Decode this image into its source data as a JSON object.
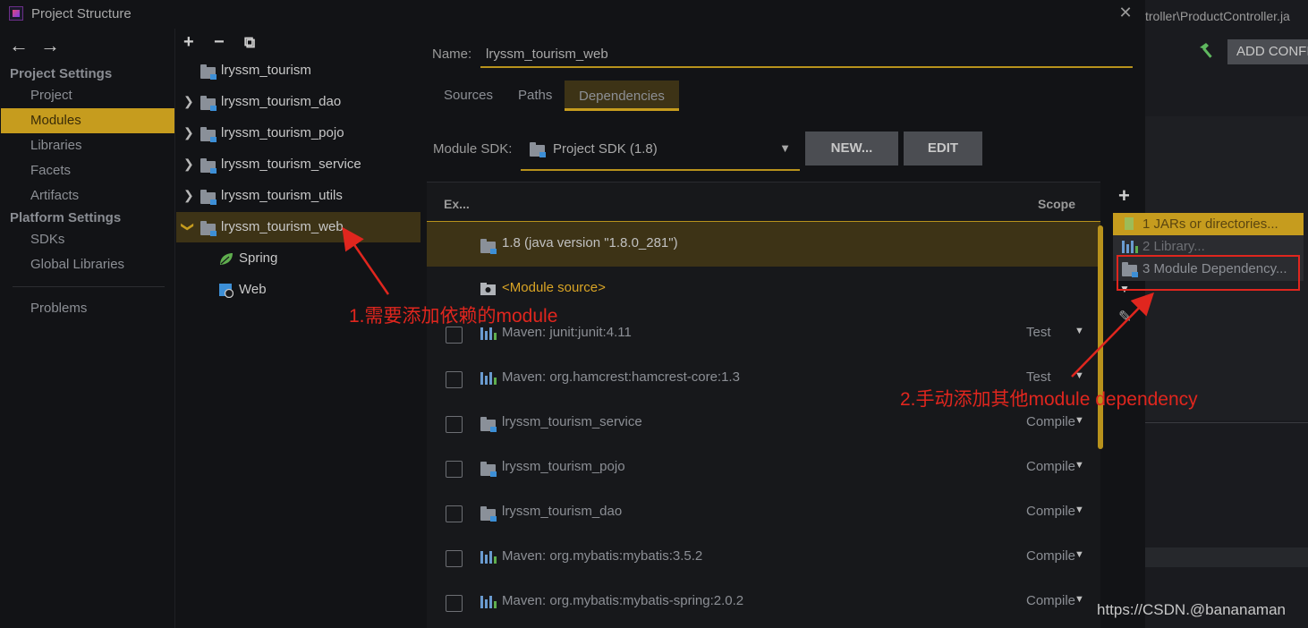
{
  "window": {
    "title": "Project Structure"
  },
  "background_ide": {
    "path": "troller\\ProductController.ja",
    "run_config_button": "ADD CONFI"
  },
  "nav": {
    "back": "←",
    "forward": "→",
    "project_settings_heading": "Project Settings",
    "project_settings_items": [
      "Project",
      "Modules",
      "Libraries",
      "Facets",
      "Artifacts"
    ],
    "platform_settings_heading": "Platform Settings",
    "platform_settings_items": [
      "SDKs",
      "Global Libraries"
    ],
    "problems": "Problems",
    "selected": "Modules"
  },
  "tree": {
    "toolbar": {
      "add": "+",
      "remove": "−",
      "copy": "⧉"
    },
    "items": [
      {
        "label": "lryssm_tourism",
        "expandable": false
      },
      {
        "label": "lryssm_tourism_dao",
        "expandable": true
      },
      {
        "label": "lryssm_tourism_pojo",
        "expandable": true
      },
      {
        "label": "lryssm_tourism_service",
        "expandable": true
      },
      {
        "label": "lryssm_tourism_utils",
        "expandable": true
      },
      {
        "label": "lryssm_tourism_web",
        "expandable": true,
        "expanded": true,
        "selected": true
      },
      {
        "label": "Spring",
        "child": true
      },
      {
        "label": "Web",
        "child": true
      }
    ]
  },
  "module": {
    "name_label": "Name:",
    "name_value": "lryssm_tourism_web",
    "tabs": [
      "Sources",
      "Paths",
      "Dependencies"
    ],
    "active_tab": "Dependencies",
    "sdk_label": "Module SDK:",
    "sdk_value": "Project SDK (1.8)",
    "new_button": "NEW...",
    "edit_button": "EDIT"
  },
  "dependencies": {
    "col_export": "Ex...",
    "col_scope": "Scope",
    "rows": [
      {
        "label": "1.8 (java version \"1.8.0_281\")",
        "scope": "",
        "icon": "sdk-folder-icon",
        "selected": true
      },
      {
        "label": "<Module source>",
        "scope": "",
        "icon": "module-source-icon"
      },
      {
        "label": "Maven: junit:junit:4.11",
        "scope": "Test",
        "icon": "library-bars-icon"
      },
      {
        "label": "Maven: org.hamcrest:hamcrest-core:1.3",
        "scope": "Test",
        "icon": "library-bars-icon"
      },
      {
        "label": "lryssm_tourism_service",
        "scope": "Compile",
        "icon": "module-folder-icon"
      },
      {
        "label": "lryssm_tourism_pojo",
        "scope": "Compile",
        "icon": "module-folder-icon"
      },
      {
        "label": "lryssm_tourism_dao",
        "scope": "Compile",
        "icon": "module-folder-icon"
      },
      {
        "label": "Maven: org.mybatis:mybatis:3.5.2",
        "scope": "Compile",
        "icon": "library-bars-icon"
      },
      {
        "label": "Maven: org.mybatis:mybatis-spring:2.0.2",
        "scope": "Compile",
        "icon": "library-bars-icon"
      }
    ]
  },
  "side_toolbar": {
    "add": "+",
    "edit": "✎"
  },
  "popup": {
    "items": [
      {
        "label": "1  JARs or directories..."
      },
      {
        "label": "2  Library..."
      },
      {
        "label": "3  Module Dependency..."
      }
    ]
  },
  "annotations": {
    "note1": "1.需要添加依赖的module",
    "note2": "2.手动添加其他module dependency",
    "color": "#e0261e"
  },
  "watermark": "https://CSDN.@bananaman"
}
